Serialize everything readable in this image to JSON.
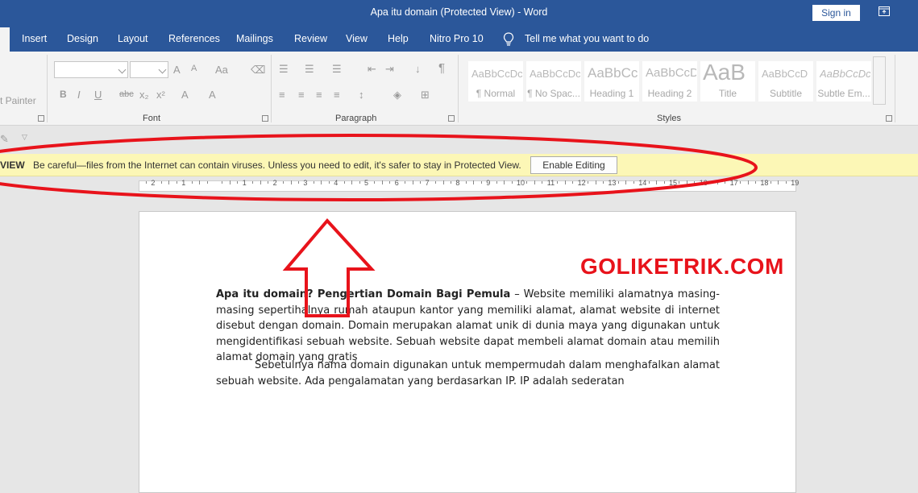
{
  "window": {
    "title": "Apa itu domain (Protected View)  -  Word",
    "sign_in": "Sign in"
  },
  "tabs": [
    {
      "label": "Insert"
    },
    {
      "label": "Design"
    },
    {
      "label": "Layout"
    },
    {
      "label": "References"
    },
    {
      "label": "Mailings"
    },
    {
      "label": "Review"
    },
    {
      "label": "View"
    },
    {
      "label": "Help"
    },
    {
      "label": "Nitro Pro 10"
    }
  ],
  "tell_me": "Tell me what you want to do",
  "ribbon": {
    "clipboard_partial": "t Painter",
    "groups": {
      "font": "Font",
      "paragraph": "Paragraph",
      "styles": "Styles"
    },
    "font_icons": [
      "B",
      "I",
      "U",
      "abc",
      "x₂",
      "x²",
      "A",
      "A"
    ],
    "styles": [
      {
        "sample": "AaBbCcDc",
        "name": "¶ Normal"
      },
      {
        "sample": "AaBbCcDc",
        "name": "¶ No Spac..."
      },
      {
        "sample": "AaBbCc",
        "name": "Heading 1"
      },
      {
        "sample": "AaBbCcD",
        "name": "Heading 2"
      },
      {
        "sample": "AaB",
        "name": "Title"
      },
      {
        "sample": "AaBbCcD",
        "name": "Subtitle"
      },
      {
        "sample": "AaBbCcDc",
        "name": "Subtle Em..."
      }
    ]
  },
  "protected_view": {
    "title": "VIEW",
    "message": "Be careful—files from the Internet can contain viruses. Unless you need to edit, it's safer to stay in Protected View.",
    "enable_button": "Enable Editing"
  },
  "ruler": {
    "labels": [
      "2",
      "1",
      "1",
      "2",
      "3",
      "4",
      "5",
      "6",
      "7",
      "8",
      "9",
      "10",
      "11",
      "12",
      "13",
      "14",
      "15",
      "16",
      "17",
      "18",
      "19"
    ]
  },
  "document": {
    "watermark": "GOLIKETRIK.COM",
    "para1_bold": "Apa itu domain? Pengertian Domain Bagi Pemula",
    "para1_rest": " – Website memiliki alamatnya masing-masing sepertihalnya rumah ataupun kantor yang memiliki alamat, alamat website di internet disebut dengan domain. Domain merupakan alamat unik di dunia maya yang digunakan untuk mengidentifikasi sebuah website. Sebuah website dapat membeli alamat domain atau memilih alamat domain yang gratis",
    "para2": "Sebetulnya nama domain digunakan untuk mempermudah dalam menghafalkan alamat sebuah website. Ada pengalamatan yang berdasarkan IP. IP adalah sederatan"
  },
  "colors": {
    "title_bar": "#2b579a",
    "protected_bar": "#fcf7b6",
    "annotation": "#e8131b"
  }
}
